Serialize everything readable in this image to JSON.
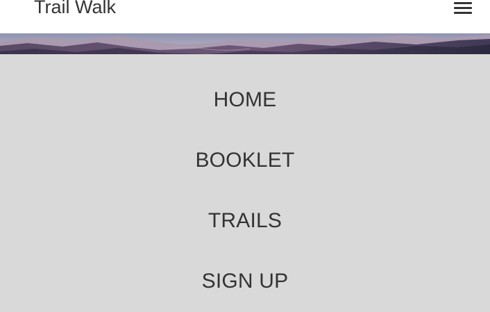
{
  "header": {
    "title": "Trail Walk",
    "menu_icon": "hamburger-menu-icon"
  },
  "hero": {
    "description_icon": "mountain-landscape-image"
  },
  "nav": {
    "items": [
      {
        "label": "HOME"
      },
      {
        "label": "BOOKLET"
      },
      {
        "label": "TRAILS"
      },
      {
        "label": "SIGN UP"
      }
    ]
  },
  "colors": {
    "header_bg": "#ffffff",
    "panel_bg": "#d9d9d9",
    "text": "#333333"
  }
}
